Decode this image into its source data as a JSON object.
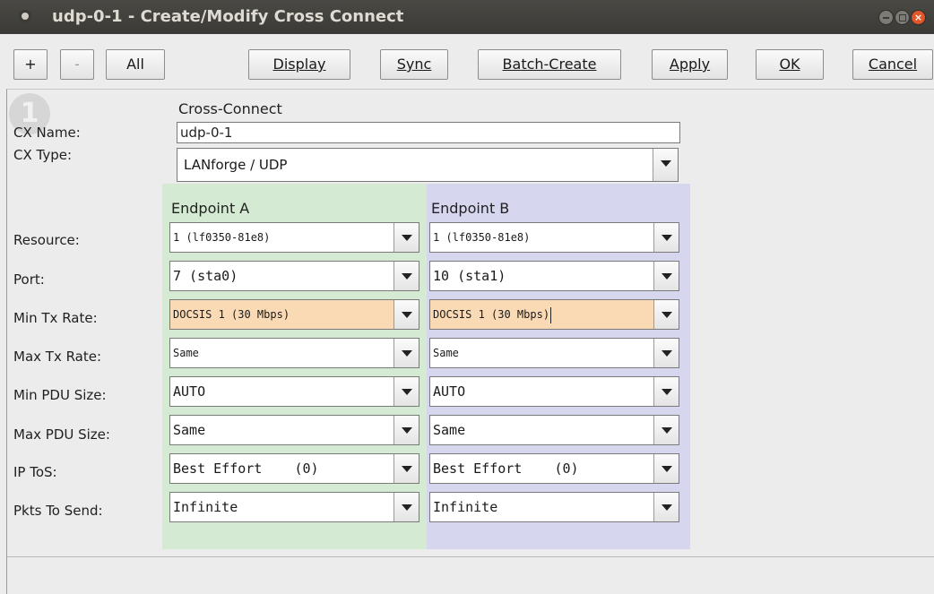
{
  "window": {
    "title": "udp-0-1 - Create/Modify Cross Connect"
  },
  "toolbar": {
    "plus": "+",
    "minus": "-",
    "all": "All",
    "display": "Display",
    "sync": "Sync",
    "batch_create": "Batch-Create",
    "apply": "Apply",
    "ok": "OK",
    "cancel": "Cancel"
  },
  "badge": {
    "number": "1"
  },
  "form": {
    "section_title": "Cross-Connect",
    "cx_name_label": "CX Name:",
    "cx_name_value": "udp-0-1",
    "cx_type_label": "CX Type:",
    "cx_type_value": "LANforge / UDP",
    "endpoint_a_title": "Endpoint A",
    "endpoint_b_title": "Endpoint B",
    "rows": [
      {
        "label": "Resource:",
        "a": "1 (lf0350-81e8)",
        "b": "1 (lf0350-81e8)"
      },
      {
        "label": "Port:",
        "a": "7 (sta0)",
        "b": "10 (sta1)"
      },
      {
        "label": "Min Tx Rate:",
        "a": "DOCSIS 1 (30 Mbps)",
        "b": "DOCSIS 1 (30 Mbps)"
      },
      {
        "label": "Max Tx Rate:",
        "a": "Same",
        "b": "Same"
      },
      {
        "label": "Min PDU Size:",
        "a": "AUTO",
        "b": "AUTO"
      },
      {
        "label": "Max PDU Size:",
        "a": "Same",
        "b": "Same"
      },
      {
        "label": "IP ToS:",
        "a": "Best Effort    (0)",
        "b": "Best Effort    (0)"
      },
      {
        "label": "Pkts To Send:",
        "a": "Infinite",
        "b": "Infinite"
      }
    ]
  },
  "colors": {
    "endpoint_a_bg": "#d4ead3",
    "endpoint_b_bg": "#d6d6ef",
    "highlight_field": "#fad9b5",
    "close_button": "#e2572a"
  }
}
